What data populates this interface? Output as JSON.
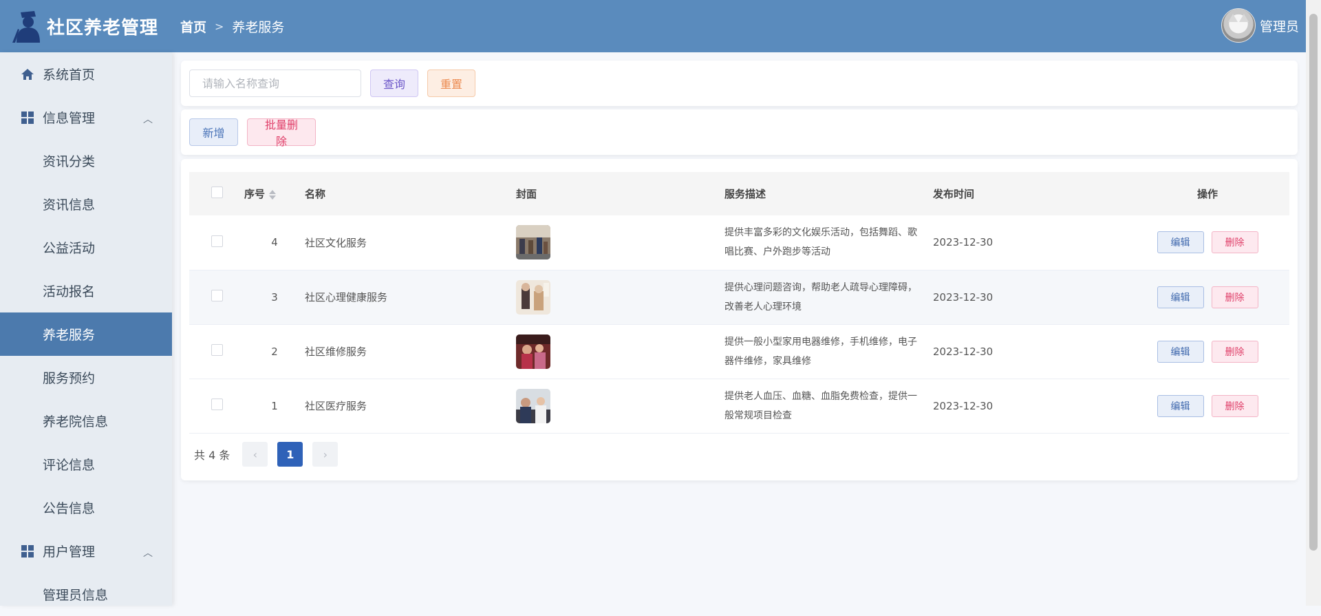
{
  "app": {
    "title": "社区养老管理"
  },
  "breadcrumb": {
    "home": "首页",
    "current": "养老服务"
  },
  "user": {
    "name": "管理员"
  },
  "sidebar": {
    "items": [
      {
        "label": "系统首页"
      },
      {
        "label": "信息管理"
      },
      {
        "label": "资讯分类"
      },
      {
        "label": "资讯信息"
      },
      {
        "label": "公益活动"
      },
      {
        "label": "活动报名"
      },
      {
        "label": "养老服务"
      },
      {
        "label": "服务预约"
      },
      {
        "label": "养老院信息"
      },
      {
        "label": "评论信息"
      },
      {
        "label": "公告信息"
      },
      {
        "label": "用户管理"
      },
      {
        "label": "管理员信息"
      }
    ],
    "active": "养老服务"
  },
  "search": {
    "placeholder": "请输入名称查询",
    "value": "",
    "query_label": "查询",
    "reset_label": "重置"
  },
  "actions": {
    "add_label": "新增",
    "batch_delete_label": "批量删除"
  },
  "table": {
    "headers": {
      "id": "序号",
      "name": "名称",
      "cover": "封面",
      "desc": "服务描述",
      "time": "发布时间",
      "op": "操作"
    },
    "rows": [
      {
        "id": "4",
        "name": "社区文化服务",
        "desc": "提供丰富多彩的文化娱乐活动，包括舞蹈、歌唱比赛、户外跑步等活动",
        "time": "2023-12-30",
        "edit": "编辑",
        "delete": "删除"
      },
      {
        "id": "3",
        "name": "社区心理健康服务",
        "desc": "提供心理问题咨询，帮助老人疏导心理障碍，改善老人心理环境",
        "time": "2023-12-30",
        "edit": "编辑",
        "delete": "删除"
      },
      {
        "id": "2",
        "name": "社区维修服务",
        "desc": "提供一般小型家用电器维修，手机维修，电子器件维修，家具维修",
        "time": "2023-12-30",
        "edit": "编辑",
        "delete": "删除"
      },
      {
        "id": "1",
        "name": "社区医疗服务",
        "desc": "提供老人血压、血糖、血脂免费检查，提供一般常规项目检查",
        "time": "2023-12-30",
        "edit": "编辑",
        "delete": "删除"
      }
    ]
  },
  "pagination": {
    "total": "共 4 条",
    "current_page": "1",
    "prev": "‹",
    "next": "›"
  },
  "colors": {
    "header": "#5a8bbd",
    "active_menu": "#4c7aad",
    "sidebar": "#e7ecf2"
  }
}
